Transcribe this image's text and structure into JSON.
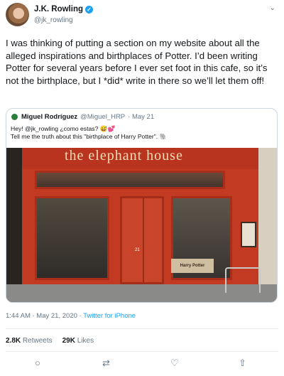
{
  "author": {
    "name": "J.K. Rowling",
    "handle": "@jk_rowling",
    "verified_icon": "verified-badge-icon"
  },
  "tweet": {
    "text": "I was thinking of putting a section on my website about all the alleged inspirations and birthplaces of Potter. I’d been writing Potter for several years before I ever set foot in this cafe, so it’s not the birthplace, but I *did* write in there so we’ll let them off!"
  },
  "quoted": {
    "name": "Miguel Rodríguez",
    "handle": "@Miguel_HRP",
    "date": "· May 21",
    "line1": "Hey! @jk_rowling ¿como estas? 😅💕",
    "line2": "Tell me the truth about this \"birthplace of Harry Potter\". 🐘",
    "photo": {
      "sign": "the elephant house",
      "door_number": "21",
      "plaque": "Harry Potter"
    }
  },
  "meta": {
    "time": "1:44 AM · May 21, 2020 · ",
    "source": "Twitter for iPhone"
  },
  "stats": {
    "retweets_count": "2.8K",
    "retweets_label": "Retweets",
    "likes_count": "29K",
    "likes_label": "Likes"
  },
  "actions": {
    "reply": "○",
    "retweet": "⇄",
    "like": "♡",
    "share": "⇧"
  },
  "colors": {
    "accent": "#1da1f2",
    "facade": "#c23a22"
  }
}
